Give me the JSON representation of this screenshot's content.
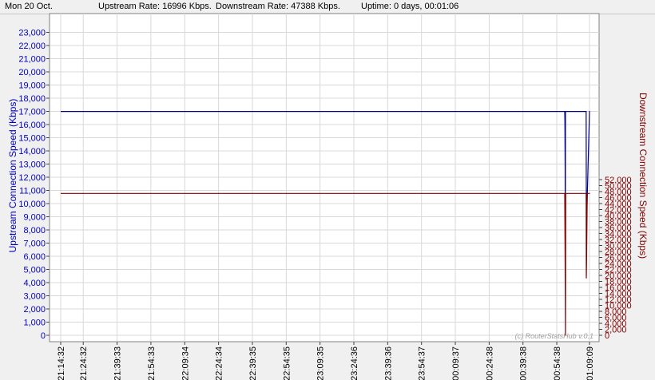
{
  "status": {
    "date": "Mon 20 Oct.",
    "upstream": "Upstream Rate: 16996 Kbps.",
    "downstream": "Downstream Rate: 47388 Kbps.",
    "uptime": "Uptime: 0 days, 00:01:06"
  },
  "watermark": "(c) RouterStatsHub v.0.1",
  "colors": {
    "upstream": "#000080",
    "downstream": "#800000",
    "grid": "#d8d8d8",
    "upAxisText": "#0000c0",
    "downAxisText": "#800000"
  },
  "chart_data": {
    "type": "line",
    "ylabel_left": "Upstream Connection Speed (Kbps)",
    "ylabel_right": "Downstream Connection Speed (Kbps)",
    "ylim_left": [
      0,
      24000
    ],
    "ylim_right": [
      0,
      53000
    ],
    "yticks_left": [
      0,
      1000,
      2000,
      3000,
      4000,
      5000,
      6000,
      7000,
      8000,
      9000,
      10000,
      11000,
      12000,
      13000,
      14000,
      15000,
      16000,
      17000,
      18000,
      19000,
      20000,
      21000,
      22000,
      23000
    ],
    "yticks_right": [
      0,
      2000,
      4000,
      6000,
      8000,
      10000,
      12000,
      14000,
      16000,
      18000,
      20000,
      22000,
      24000,
      26000,
      28000,
      30000,
      32000,
      34000,
      36000,
      38000,
      40000,
      42000,
      44000,
      46000,
      48000,
      50000,
      52000
    ],
    "x_tick_labels": [
      "21:14:32",
      "21:24:32",
      "21:39:33",
      "21:54:33",
      "22:09:34",
      "22:24:34",
      "22:39:35",
      "22:54:35",
      "23:09:35",
      "23:24:36",
      "23:39:36",
      "23:54:37",
      "00:09:37",
      "00:24:38",
      "00:39:38",
      "00:54:38",
      "01:09:09"
    ],
    "grid": true,
    "series": [
      {
        "key": "up",
        "axis": "left",
        "x": [
          "21:14:32",
          "00:58:10",
          "00:58:15",
          "00:58:20",
          "00:58:25",
          "00:58:30",
          "01:07:40",
          "01:07:45",
          "01:07:50",
          "01:09:09",
          "01:09:20"
        ],
        "values": [
          16996,
          16996,
          16200,
          12700,
          4200,
          16996,
          16996,
          10900,
          8500,
          16996,
          16996
        ]
      },
      {
        "key": "down",
        "axis": "right",
        "x": [
          "21:14:32",
          "00:58:10",
          "00:58:20",
          "00:58:30",
          "00:58:35",
          "00:58:40",
          "01:07:40",
          "01:07:45",
          "01:07:50",
          "01:08:10",
          "01:08:20",
          "01:09:20"
        ],
        "values": [
          47388,
          47388,
          24000,
          0,
          47388,
          47388,
          47388,
          19000,
          23800,
          47388,
          47388,
          47388
        ]
      }
    ]
  }
}
